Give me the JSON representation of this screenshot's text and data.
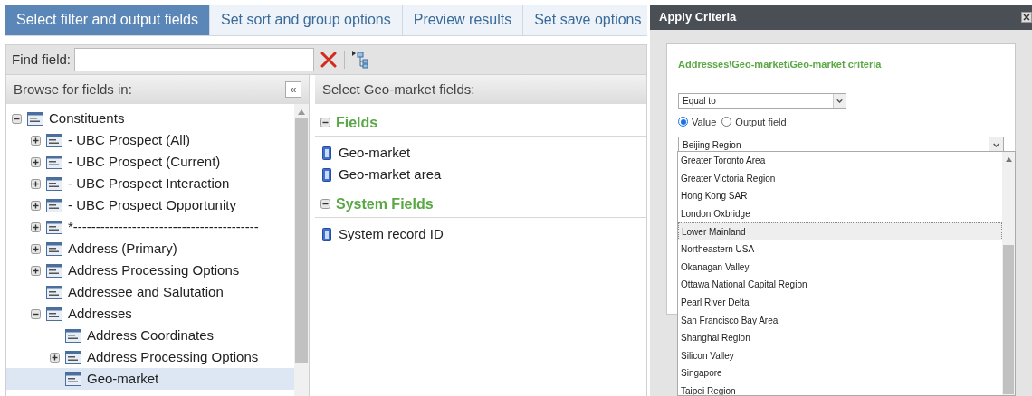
{
  "tabs": [
    {
      "label": "Select filter and output fields",
      "selected": true
    },
    {
      "label": "Set sort and group options",
      "selected": false
    },
    {
      "label": "Preview results",
      "selected": false
    },
    {
      "label": "Set save options",
      "selected": false
    }
  ],
  "find_field": {
    "label": "Find field:"
  },
  "browse_panel": {
    "title": "Browse for fields in:",
    "collapse": "«",
    "tree": [
      {
        "label": "Constituents",
        "kind": "group",
        "expanded": true,
        "selected": false,
        "children": [
          {
            "label": "- UBC Prospect (All)",
            "kind": "group",
            "expanded": false,
            "selected": false
          },
          {
            "label": "- UBC Prospect (Current)",
            "kind": "group",
            "expanded": false,
            "selected": false
          },
          {
            "label": "- UBC Prospect Interaction",
            "kind": "group",
            "expanded": false,
            "selected": false
          },
          {
            "label": "- UBC Prospect Opportunity",
            "kind": "group",
            "expanded": false,
            "selected": false
          },
          {
            "label": "*-----------------------------------------",
            "kind": "group",
            "expanded": false,
            "selected": false
          },
          {
            "label": "Address (Primary)",
            "kind": "group",
            "expanded": false,
            "selected": false
          },
          {
            "label": "Address Processing Options",
            "kind": "group",
            "expanded": false,
            "selected": false
          },
          {
            "label": "Addressee and Salutation",
            "kind": "leaf",
            "selected": false
          },
          {
            "label": "Addresses",
            "kind": "group",
            "expanded": true,
            "selected": false,
            "children": [
              {
                "label": "Address Coordinates",
                "kind": "leaf",
                "selected": false
              },
              {
                "label": "Address Processing Options",
                "kind": "group",
                "expanded": false,
                "selected": false
              },
              {
                "label": "Geo-market",
                "kind": "leaf",
                "selected": true
              }
            ]
          }
        ]
      }
    ]
  },
  "fields_panel": {
    "title": "Select Geo-market fields:",
    "sections": [
      {
        "title": "Fields",
        "items": [
          "Geo-market",
          "Geo-market area"
        ]
      },
      {
        "title": "System Fields",
        "items": [
          "System record ID"
        ]
      }
    ]
  },
  "dialog": {
    "title": "Apply Criteria",
    "heading": "Addresses\\Geo-market\\Geo-market criteria",
    "operator": "Equal to",
    "radios": [
      {
        "label": "Value",
        "selected": true
      },
      {
        "label": "Output field",
        "selected": false
      }
    ],
    "value": "Beijing Region",
    "options": [
      {
        "label": "Greater Toronto Area",
        "selected": false
      },
      {
        "label": "Greater Victoria Region",
        "selected": false
      },
      {
        "label": "Hong Kong SAR",
        "selected": false
      },
      {
        "label": "London Oxbridge",
        "selected": false
      },
      {
        "label": "Lower Mainland",
        "selected": true
      },
      {
        "label": "Northeastern USA",
        "selected": false
      },
      {
        "label": "Okanagan Valley",
        "selected": false
      },
      {
        "label": "Ottawa National Capital Region",
        "selected": false
      },
      {
        "label": "Pearl River Delta",
        "selected": false
      },
      {
        "label": "San Francisco Bay Area",
        "selected": false
      },
      {
        "label": "Shanghai Region",
        "selected": false
      },
      {
        "label": "Silicon Valley",
        "selected": false
      },
      {
        "label": "Singapore",
        "selected": false
      },
      {
        "label": "Taipei Region",
        "selected": false
      }
    ]
  }
}
